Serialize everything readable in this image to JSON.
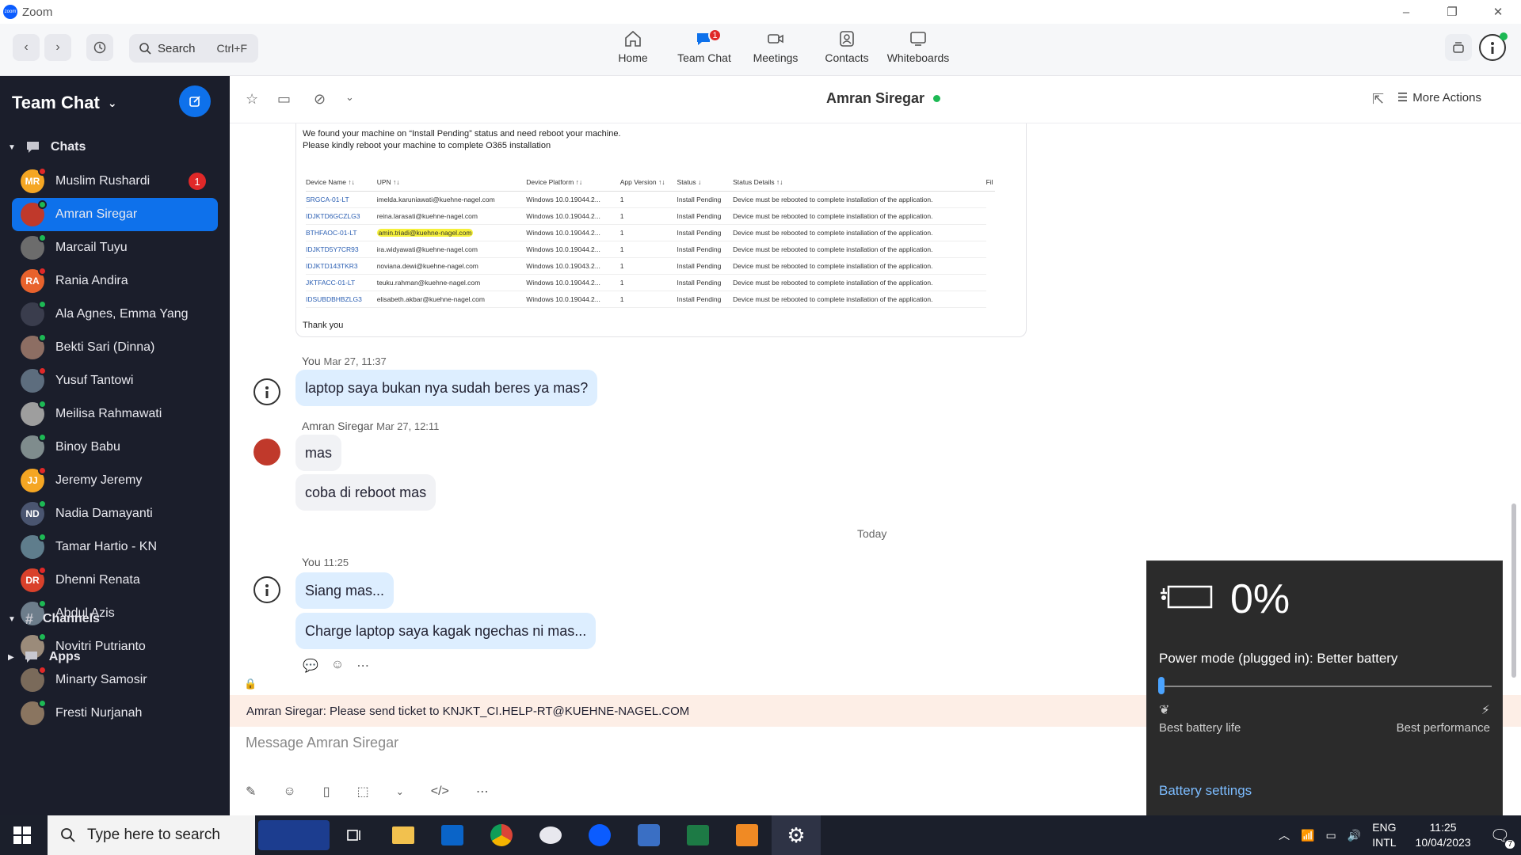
{
  "window": {
    "app_title": "Zoom",
    "minimize": "–",
    "restore": "❐",
    "close": "✕"
  },
  "topnav": {
    "search_label": "Search",
    "search_shortcut": "Ctrl+F",
    "tabs": [
      {
        "label": "Home",
        "icon": "home-icon"
      },
      {
        "label": "Team Chat",
        "icon": "chat-icon",
        "badge": "1"
      },
      {
        "label": "Meetings",
        "icon": "video-icon"
      },
      {
        "label": "Contacts",
        "icon": "contacts-icon"
      },
      {
        "label": "Whiteboards",
        "icon": "whiteboard-icon"
      }
    ]
  },
  "sidebar": {
    "title": "Team Chat",
    "chats_section": "Chats",
    "channels_section": "Channels",
    "apps_section": "Apps",
    "items": [
      {
        "name": "Muslim Rushardi",
        "initials": "MR",
        "color": "#f5a623",
        "badge": "1"
      },
      {
        "name": "Amran Siregar",
        "initials": "",
        "color": "#c0392b",
        "active": true
      },
      {
        "name": "Marcail Tuyu",
        "initials": "",
        "color": "#6c6c6c"
      },
      {
        "name": "Rania Andira",
        "initials": "RA",
        "color": "#e8622c"
      },
      {
        "name": "Ala Agnes, Emma Yang",
        "initials": "",
        "color": "#3a3d4d"
      },
      {
        "name": "Bekti Sari (Dinna)",
        "initials": "",
        "color": "#8d6e63"
      },
      {
        "name": "Yusuf Tantowi",
        "initials": "",
        "color": "#5d6d7e"
      },
      {
        "name": "Meilisa Rahmawati",
        "initials": "",
        "color": "#9e9e9e"
      },
      {
        "name": "Binoy Babu",
        "initials": "",
        "color": "#7f8c8d"
      },
      {
        "name": "Jeremy Jeremy",
        "initials": "JJ",
        "color": "#f5a623"
      },
      {
        "name": "Nadia Damayanti",
        "initials": "ND",
        "color": "#4a5570"
      },
      {
        "name": "Tamar Hartio - KN",
        "initials": "",
        "color": "#5f7d8c"
      },
      {
        "name": "Dhenni Renata",
        "initials": "DR",
        "color": "#d9412b"
      },
      {
        "name": "Abdul Azis",
        "initials": "",
        "color": "#6d7d8b"
      },
      {
        "name": "Novitri Putrianto",
        "initials": "",
        "color": "#9b8b7a"
      },
      {
        "name": "Minarty Samosir",
        "initials": "",
        "color": "#7a6a5a"
      },
      {
        "name": "Fresti Nurjanah",
        "initials": "",
        "color": "#8a7560"
      }
    ]
  },
  "chat": {
    "peer_name": "Amran Siregar",
    "more_actions": "More Actions",
    "image": {
      "line1": "We found your machine on “Install Pending” status and need reboot your machine.",
      "line2": "Please kindly reboot your machine to complete O365 installation",
      "headers": [
        "Device Name ↑↓",
        "UPN ↑↓",
        "Device Platform ↑↓",
        "App Version ↑↓",
        "Status ↓",
        "Status Details ↑↓",
        "Fil"
      ],
      "rows": [
        [
          "SRGCA-01-LT",
          "imelda.karuniawati@kuehne-nagel.com",
          "Windows 10.0.19044.2...",
          "1",
          "Install Pending",
          "Device must be rebooted to complete installation of the application."
        ],
        [
          "IDJKTD6GCZLG3",
          "reina.larasati@kuehne-nagel.com",
          "Windows 10.0.19044.2...",
          "1",
          "Install Pending",
          "Device must be rebooted to complete installation of the application."
        ],
        [
          "BTHFAOC-01-LT",
          "amin.triadi@kuehne-nagel.com",
          "Windows 10.0.19044.2...",
          "1",
          "Install Pending",
          "Device must be rebooted to complete installation of the application."
        ],
        [
          "IDJKTD5Y7CR93",
          "ira.widyawati@kuehne-nagel.com",
          "Windows 10.0.19044.2...",
          "1",
          "Install Pending",
          "Device must be rebooted to complete installation of the application."
        ],
        [
          "IDJKTD143TKR3",
          "noviana.dewi@kuehne-nagel.com",
          "Windows 10.0.19043.2...",
          "1",
          "Install Pending",
          "Device must be rebooted to complete installation of the application."
        ],
        [
          "JKTFACC-01-LT",
          "teuku.rahman@kuehne-nagel.com",
          "Windows 10.0.19044.2...",
          "1",
          "Install Pending",
          "Device must be rebooted to complete installation of the application."
        ],
        [
          "IDSUBDBHBZLG3",
          "elisabeth.akbar@kuehne-nagel.com",
          "Windows 10.0.19044.2...",
          "1",
          "Install Pending",
          "Device must be rebooted to complete installation of the application."
        ]
      ],
      "highlighted_row": 2,
      "footer": "Thank you"
    },
    "msg1": {
      "sender": "You",
      "time": "Mar 27, 11:37",
      "text": "laptop saya bukan nya sudah beres ya mas?"
    },
    "msg2": {
      "sender": "Amran Siregar",
      "time": "Mar 27, 12:11",
      "text1": "mas",
      "text2": "coba di reboot mas"
    },
    "today": "Today",
    "msg3": {
      "sender": "You",
      "time": "11:25",
      "text1": "Siang mas...",
      "text2": "Charge laptop saya kagak ngechas ni mas..."
    },
    "notice": "Amran Siregar: Please send ticket to KNJKT_CI.HELP-RT@KUEHNE-NAGEL.COM",
    "input_placeholder": "Message Amran Siregar"
  },
  "battery": {
    "percent": "0%",
    "mode": "Power mode (plugged in): Better battery",
    "mode_level": 0.0,
    "left_label": "Best battery life",
    "right_label": "Best performance",
    "settings_link": "Battery settings"
  },
  "taskbar": {
    "search_placeholder": "Type here to search",
    "lang": "ENG",
    "layout": "INTL",
    "time": "11:25",
    "date": "10/04/2023",
    "notif_count": "7"
  }
}
